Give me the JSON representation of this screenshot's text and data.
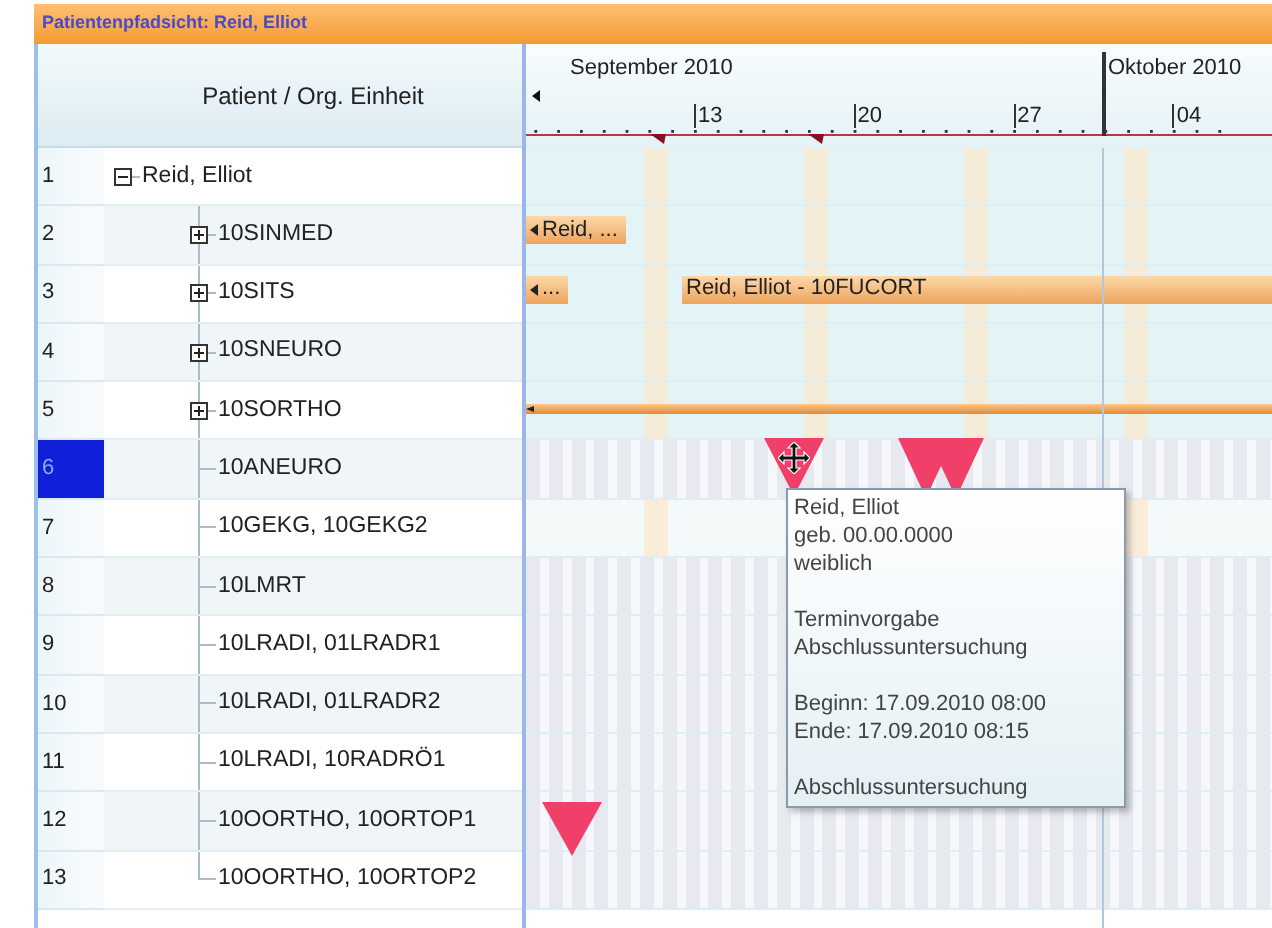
{
  "window": {
    "title": "Patientenpfadsicht: Reid, Elliot"
  },
  "columns": {
    "tree_header": "Patient / Org. Einheit"
  },
  "timeline": {
    "months": [
      {
        "label": "September 2010"
      },
      {
        "label": "Oktober 2010"
      }
    ],
    "days": [
      {
        "label": "13"
      },
      {
        "label": "20"
      },
      {
        "label": "27"
      },
      {
        "label": "04"
      }
    ]
  },
  "tree": [
    {
      "number": "1",
      "label": "Reid, Elliot",
      "kind": "group",
      "expanded": true,
      "selected": false,
      "children": [
        {
          "number": "2",
          "label": "10SINMED",
          "kind": "group",
          "expanded": false,
          "selected": false,
          "bars": [
            {
              "label": "Reid, ...",
              "kind": "clipped"
            }
          ]
        },
        {
          "number": "3",
          "label": "10SITS",
          "kind": "group",
          "expanded": false,
          "selected": false,
          "bars": [
            {
              "label": "...",
              "kind": "clipped"
            },
            {
              "label": "Reid, Elliot - 10FUCORT",
              "kind": "open"
            }
          ]
        },
        {
          "number": "4",
          "label": "10SNEURO",
          "kind": "group",
          "expanded": false,
          "selected": false
        },
        {
          "number": "5",
          "label": "10SORTHO",
          "kind": "group",
          "expanded": false,
          "selected": false,
          "bars": [
            {
              "kind": "thin"
            }
          ]
        },
        {
          "number": "6",
          "label": "10ANEURO",
          "kind": "leaf",
          "selected": true
        },
        {
          "number": "7",
          "label": "10GEKG, 10GEKG2",
          "kind": "leaf",
          "selected": false
        },
        {
          "number": "8",
          "label": "10LMRT",
          "kind": "leaf",
          "selected": false
        },
        {
          "number": "9",
          "label": "10LRADI, 01LRADR1",
          "kind": "leaf",
          "selected": false
        },
        {
          "number": "10",
          "label": "10LRADI, 01LRADR2",
          "kind": "leaf",
          "selected": false
        },
        {
          "number": "11",
          "label": "10LRADI, 10RADRÖ1",
          "kind": "leaf",
          "selected": false
        },
        {
          "number": "12",
          "label": "10OORTHO, 10ORTOP1",
          "kind": "leaf",
          "selected": false
        },
        {
          "number": "13",
          "label": "10OORTHO, 10ORTOP2",
          "kind": "leaf",
          "selected": false
        }
      ]
    }
  ],
  "tooltip": {
    "blocks": [
      [
        "Reid, Elliot",
        "geb. 00.00.0000",
        "weiblich"
      ],
      [
        "Terminvorgabe",
        "Abschlussuntersuchung"
      ],
      [
        "Beginn: 17.09.2010 08:00",
        "Ende: 17.09.2010 08:15"
      ],
      [
        "Abschlussuntersuchung"
      ]
    ]
  }
}
